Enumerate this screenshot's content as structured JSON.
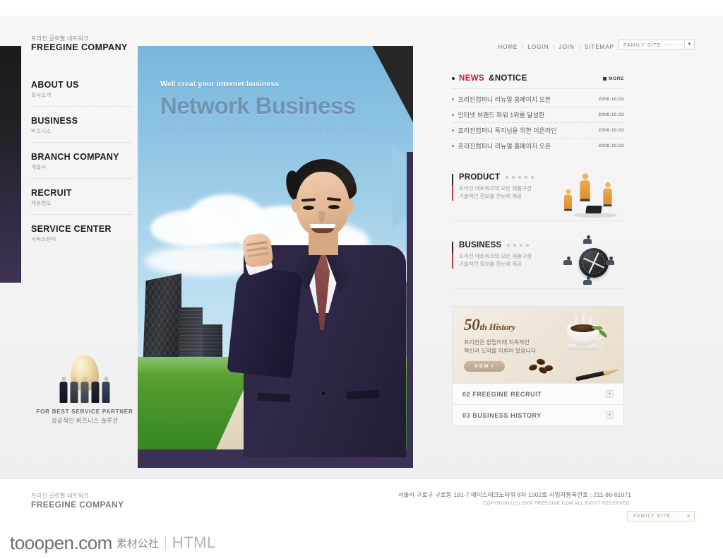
{
  "header": {
    "logo_sub": "프리진 글로벌 네트워크",
    "logo_main": "FREEGINE COMPANY",
    "nav": [
      {
        "label": "HOME"
      },
      {
        "label": "LOGIN"
      },
      {
        "label": "JOIN"
      },
      {
        "label": "SITEMAP"
      }
    ],
    "separator": "|",
    "family_site": "FAMILY SITE--------------",
    "family_site_arrow": "▼"
  },
  "sidebar": {
    "items": [
      {
        "en": "ABOUT US",
        "ko": "회사소개"
      },
      {
        "en": "BUSINESS",
        "ko": "비즈니스"
      },
      {
        "en": "BRANCH COMPANY",
        "ko": "계열사"
      },
      {
        "en": "RECRUIT",
        "ko": "채용정보"
      },
      {
        "en": "SERVICE CENTER",
        "ko": "서비스센터"
      }
    ],
    "promo": {
      "en": "FOR BEST SERVICE PARTNER",
      "ko": "성공적인 비즈니스 솔루션"
    }
  },
  "hero": {
    "kicker": "Well creat your internet business",
    "title": "Network Business",
    "subtitle": "The Best Partner of Your Happy Life"
  },
  "news": {
    "title_red": "NEWS",
    "title_dark": "&NOTICE",
    "more_label": "MORE",
    "items": [
      {
        "text": "프리진컴퍼니 리뉴얼 홈페이지 오픈",
        "date": "2008.10.02"
      },
      {
        "text": "인터넷 브랜드 파워 1위를 달성한",
        "date": "2008.10.02"
      },
      {
        "text": "프리진컴퍼니 독지님을 위한 이온라인",
        "date": "2008.10.02"
      },
      {
        "text": "프리진컴퍼니 리뉴얼 홈페이지 오픈",
        "date": "2008.10.02"
      }
    ]
  },
  "sections": [
    {
      "title": "PRODUCT",
      "desc_line1": "프리진 네트워크의 모든 제품구성",
      "desc_line2": "기술적인 정보를 한눈에 제공"
    },
    {
      "title": "BUSINESS",
      "desc_line1": "프리진 네트워크의 모든 제품구성",
      "desc_line2": "기술적인 정보를 한눈에 제공"
    }
  ],
  "history": {
    "number": "50",
    "suffix": "th History",
    "desc_line1": "프리진은 창립이래 지속적인",
    "desc_line2": "혁신과 도약을 이루어 왔습니다",
    "view_label": "VIEW +",
    "rows": [
      {
        "label": "02 FREEGINE RECRUIT",
        "plus": "+"
      },
      {
        "label": "03 BUSINESS HISTORY",
        "plus": "+"
      }
    ]
  },
  "footer": {
    "logo_sub": "프리진 글로벌 네트워크",
    "logo_main": "FREEGINE COMPANY",
    "address": "서울시 구로구 구로동 191-7 에이스테크노타워 8차 1002호  사업자등록번호 : 211-86-61071",
    "copyright": "COPYRIGHT(C) 2009 FREEGINE.COM ALL RIGHT RESERVED.",
    "family_site": "FAMILY SITE",
    "family_site_arrow": "▼"
  },
  "watermark": {
    "main": "tooopen.com",
    "cn": "素材公社",
    "html": "HTML"
  },
  "colors": {
    "accent_red": "#c8202b",
    "hero_purple": "#3c3053",
    "sky_blue": "#8ec4e4",
    "history_beige": "#ece4d7"
  }
}
